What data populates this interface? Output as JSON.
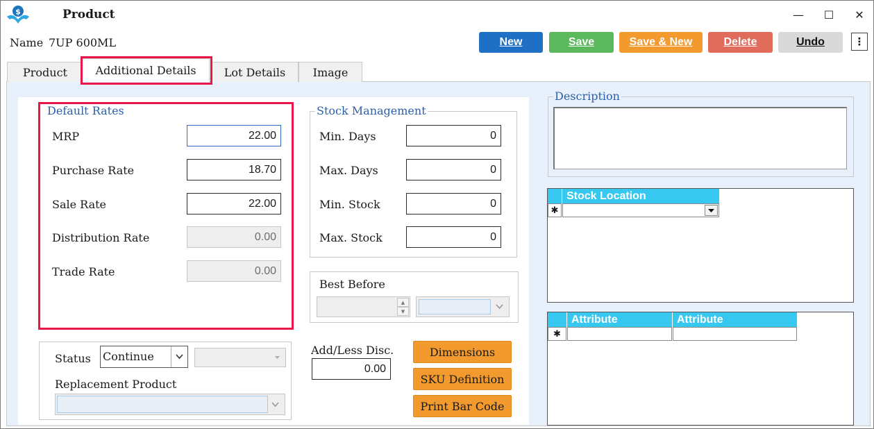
{
  "window": {
    "title": "Product",
    "minimize": "—",
    "maximize": "☐",
    "close": "✕"
  },
  "header": {
    "name_label": "Name",
    "name_value": "7UP 600ML"
  },
  "toolbar": {
    "new_label": "New",
    "save_label": "Save",
    "save_new_label": "Save & New",
    "delete_label": "Delete",
    "undo_label": "Undo",
    "more_label": "⋮",
    "colors": {
      "new": "#1f6fc5",
      "save": "#5cb85c",
      "save_new": "#f39a2f",
      "delete": "#e06c5b",
      "undo": "#d9d9d9"
    }
  },
  "tabs": [
    {
      "label": "Product"
    },
    {
      "label": "Additional Details",
      "active": true
    },
    {
      "label": "Lot Details"
    },
    {
      "label": "Image"
    }
  ],
  "default_rates": {
    "title": "Default Rates",
    "rows": [
      {
        "label": "MRP",
        "value": "22.00",
        "enabled": true
      },
      {
        "label": "Purchase Rate",
        "value": "18.70",
        "enabled": true
      },
      {
        "label": "Sale Rate",
        "value": "22.00",
        "enabled": true
      },
      {
        "label": "Distribution Rate",
        "value": "0.00",
        "enabled": false
      },
      {
        "label": "Trade Rate",
        "value": "0.00",
        "enabled": false
      }
    ]
  },
  "stock_management": {
    "title": "Stock Management",
    "rows": [
      {
        "label": "Min. Days",
        "value": "0"
      },
      {
        "label": "Max. Days",
        "value": "0"
      },
      {
        "label": "Min. Stock",
        "value": "0"
      },
      {
        "label": "Max. Stock",
        "value": "0"
      }
    ]
  },
  "best_before": {
    "label": "Best Before"
  },
  "status": {
    "label": "Status",
    "value": "Continue",
    "replacement_label": "Replacement Product"
  },
  "discount": {
    "label": "Add/Less Disc.",
    "value": "0.00"
  },
  "actions": {
    "dimensions": "Dimensions",
    "sku": "SKU Definition",
    "barcode": "Print Bar Code"
  },
  "description": {
    "title": "Description"
  },
  "stock_location_grid": {
    "header": "Stock Location",
    "new_row_marker": "✱"
  },
  "attribute_grid": {
    "headers": [
      "Attribute",
      "Attribute"
    ],
    "new_row_marker": "✱"
  },
  "icons": {
    "dropdown": "chevron-down-icon",
    "spinner_up": "▲",
    "spinner_down": "▼",
    "app_logo": "app-logo-icon"
  }
}
